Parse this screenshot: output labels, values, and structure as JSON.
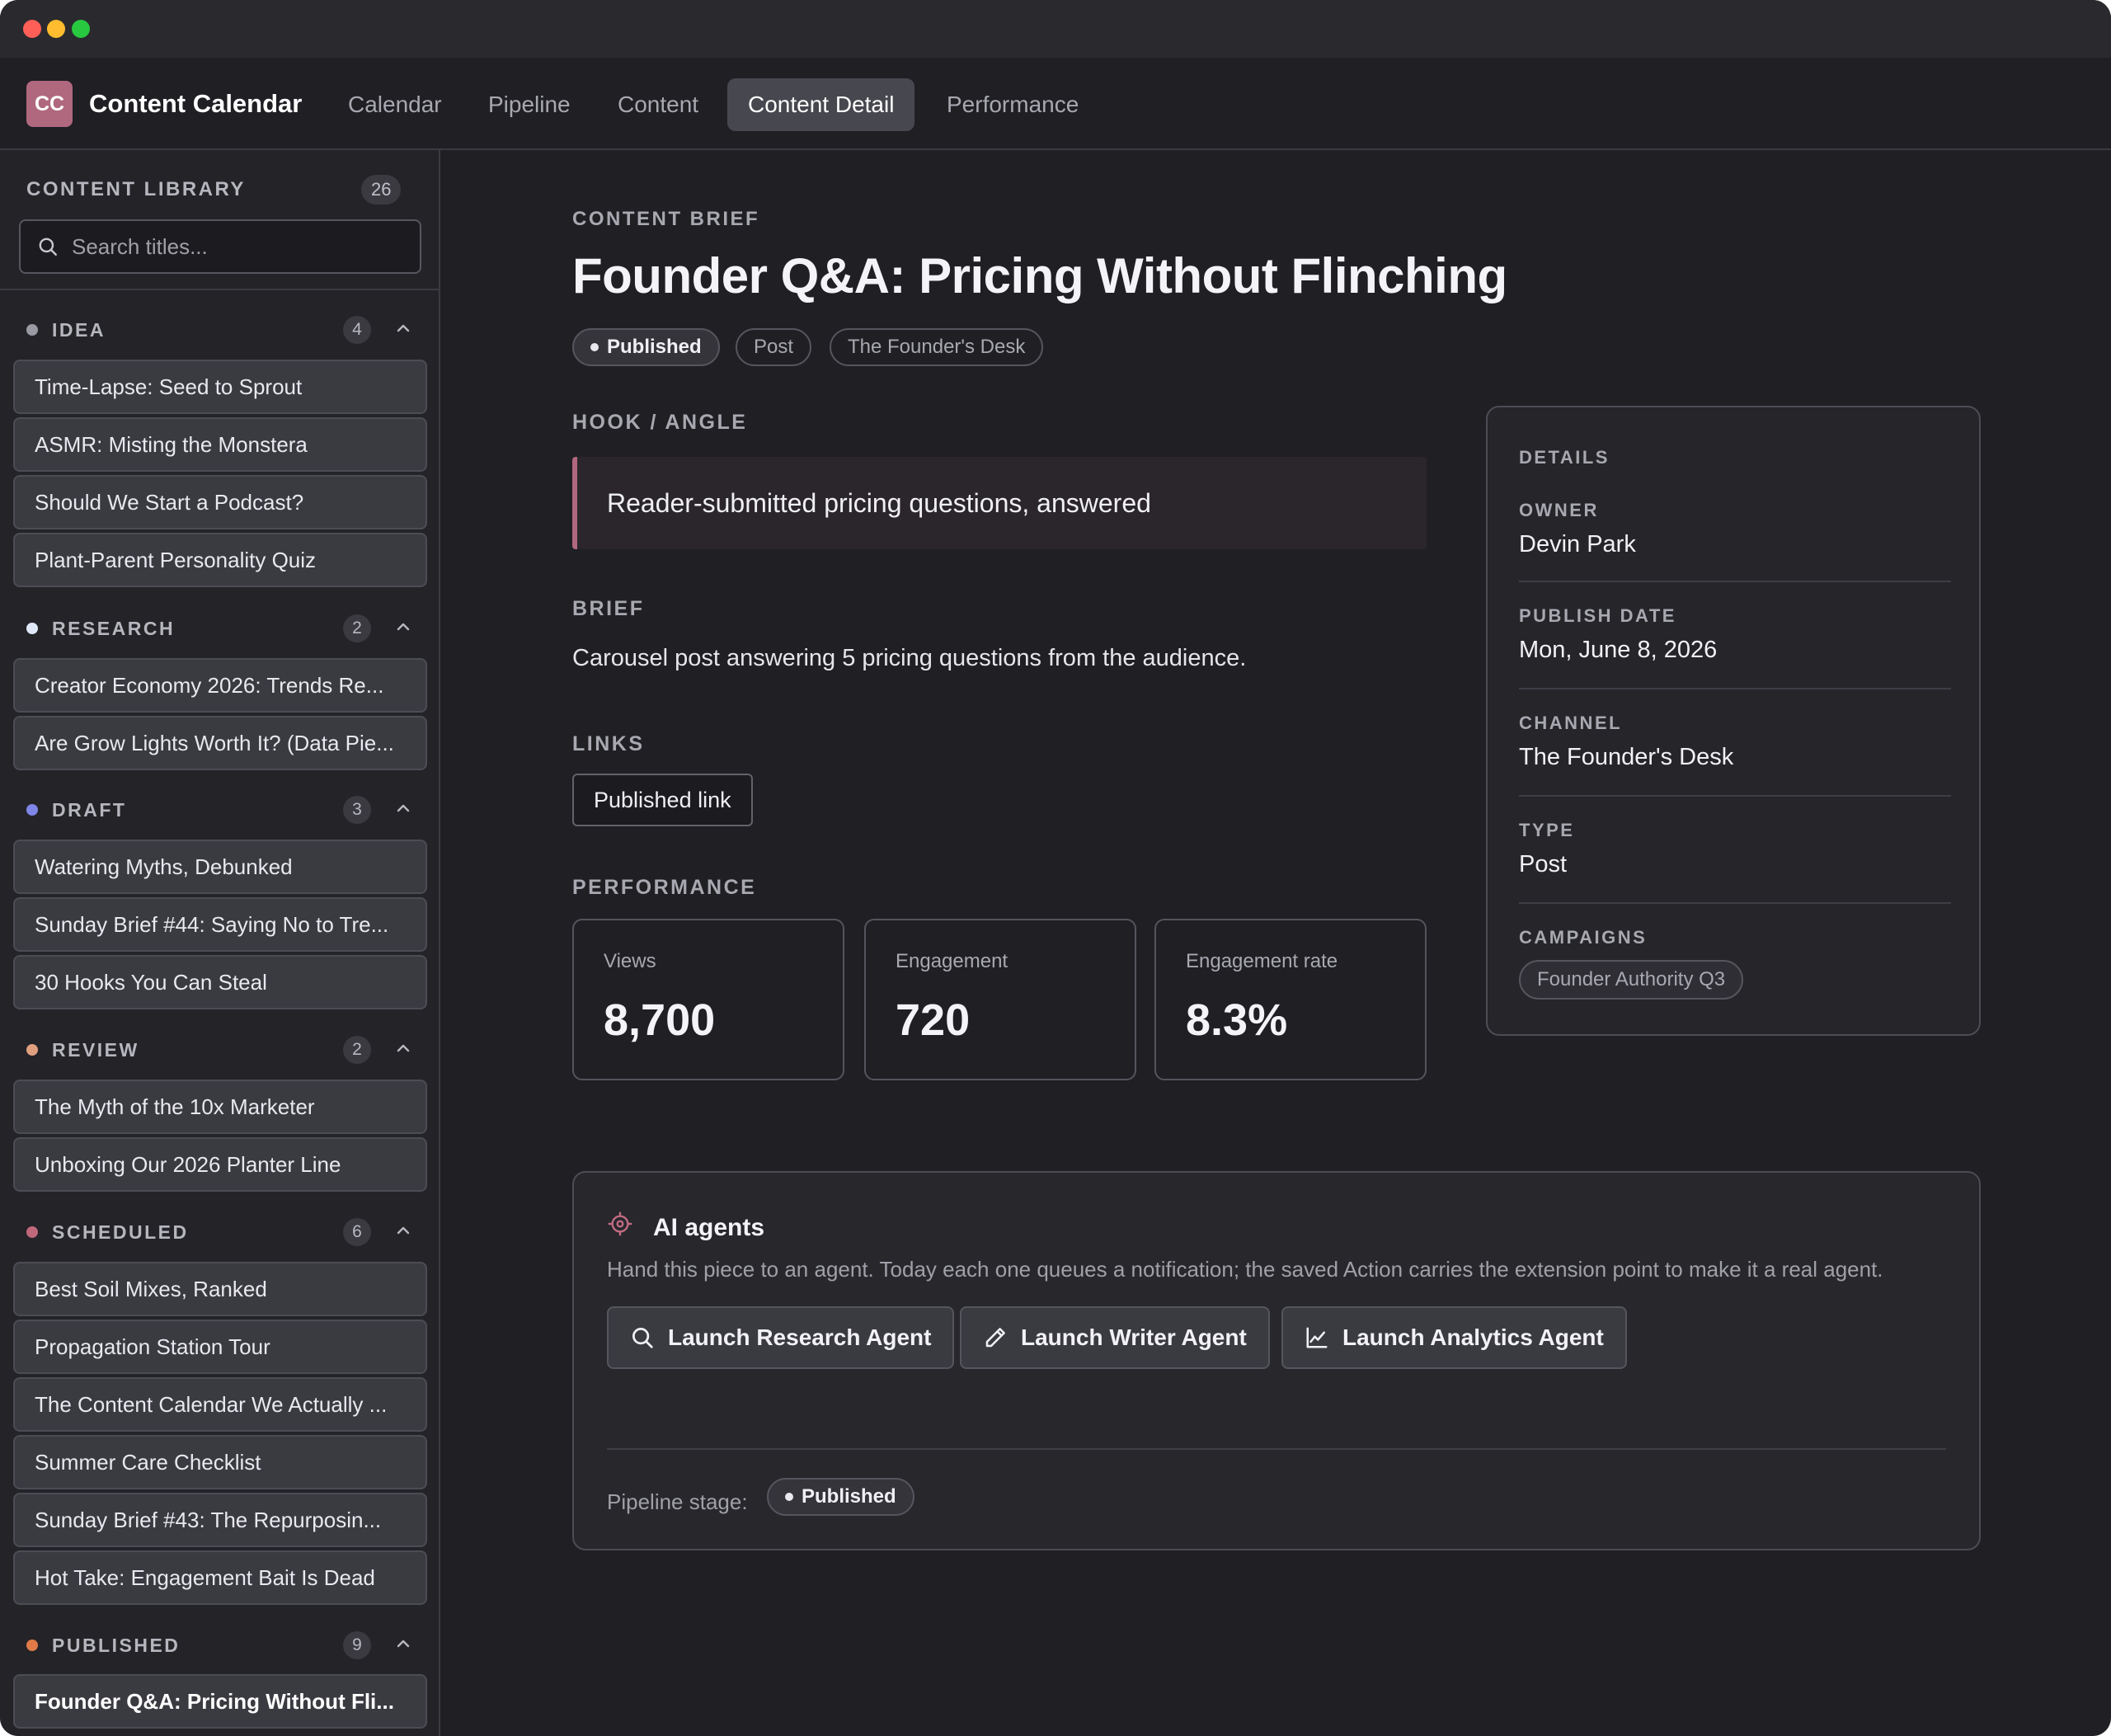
{
  "app": {
    "logo_text": "CC",
    "title": "Content Calendar",
    "nav": [
      {
        "label": "Calendar"
      },
      {
        "label": "Pipeline"
      },
      {
        "label": "Content"
      },
      {
        "label": "Content Detail"
      },
      {
        "label": "Performance"
      }
    ],
    "active_tab": "Content Detail",
    "accent": "#b0687f"
  },
  "sidebar": {
    "heading": "CONTENT LIBRARY",
    "total": "26",
    "search_placeholder": "Search titles...",
    "groups": [
      {
        "name": "IDEA",
        "count": "4",
        "color": "#9a9aa2",
        "items": [
          "Time-Lapse: Seed to Sprout",
          "ASMR: Misting the Monstera",
          "Should We Start a Podcast?",
          "Plant-Parent Personality Quiz"
        ]
      },
      {
        "name": "RESEARCH",
        "count": "2",
        "color": "#dfe8f8",
        "items": [
          "Creator Economy 2026: Trends Re...",
          "Are Grow Lights Worth It? (Data Pie..."
        ]
      },
      {
        "name": "DRAFT",
        "count": "3",
        "color": "#7f86e8",
        "items": [
          "Watering Myths, Debunked",
          "Sunday Brief #44: Saying No to Tre...",
          "30 Hooks You Can Steal"
        ]
      },
      {
        "name": "REVIEW",
        "count": "2",
        "color": "#e0a080",
        "items": [
          "The Myth of the 10x Marketer",
          "Unboxing Our 2026 Planter Line"
        ]
      },
      {
        "name": "SCHEDULED",
        "count": "6",
        "color": "#c0687c",
        "items": [
          "Best Soil Mixes, Ranked",
          "Propagation Station Tour",
          "The Content Calendar We Actually ...",
          "Summer Care Checklist",
          "Sunday Brief #43: The Repurposin...",
          "Hot Take: Engagement Bait Is Dead"
        ]
      },
      {
        "name": "PUBLISHED",
        "count": "9",
        "color": "#e07a48",
        "items": [
          "Founder Q&A: Pricing Without Fli..."
        ]
      }
    ]
  },
  "detail": {
    "eyebrow": "CONTENT BRIEF",
    "title": "Founder Q&A: Pricing Without Flinching",
    "tags": {
      "status": "Published",
      "type": "Post",
      "channel": "The Founder's Desk"
    },
    "hook_heading": "HOOK / ANGLE",
    "hook": "Reader-submitted pricing questions, answered",
    "brief_heading": "BRIEF",
    "brief": "Carousel post answering 5 pricing questions from the audience.",
    "links_heading": "LINKS",
    "link_label": "Published link",
    "performance_heading": "PERFORMANCE",
    "metrics": [
      {
        "label": "Views",
        "value": "8,700"
      },
      {
        "label": "Engagement",
        "value": "720"
      },
      {
        "label": "Engagement rate",
        "value": "8.3%"
      }
    ]
  },
  "details_panel": {
    "heading": "DETAILS",
    "owner_label": "OWNER",
    "owner": "Devin Park",
    "date_label": "PUBLISH DATE",
    "date": "Mon, June 8, 2026",
    "channel_label": "CHANNEL",
    "channel": "The Founder's Desk",
    "type_label": "TYPE",
    "type": "Post",
    "campaigns_label": "CAMPAIGNS",
    "campaign": "Founder Authority Q3"
  },
  "agents": {
    "title": "AI agents",
    "description": "Hand this piece to an agent. Today each one queues a notification; the saved Action carries the extension point to make it a real agent.",
    "buttons": [
      {
        "label": "Launch Research Agent",
        "icon": "search-icon"
      },
      {
        "label": "Launch Writer Agent",
        "icon": "pencil-icon"
      },
      {
        "label": "Launch Analytics Agent",
        "icon": "line-chart-icon"
      }
    ],
    "pipeline_label": "Pipeline stage:",
    "pipeline_stage": "Published"
  }
}
